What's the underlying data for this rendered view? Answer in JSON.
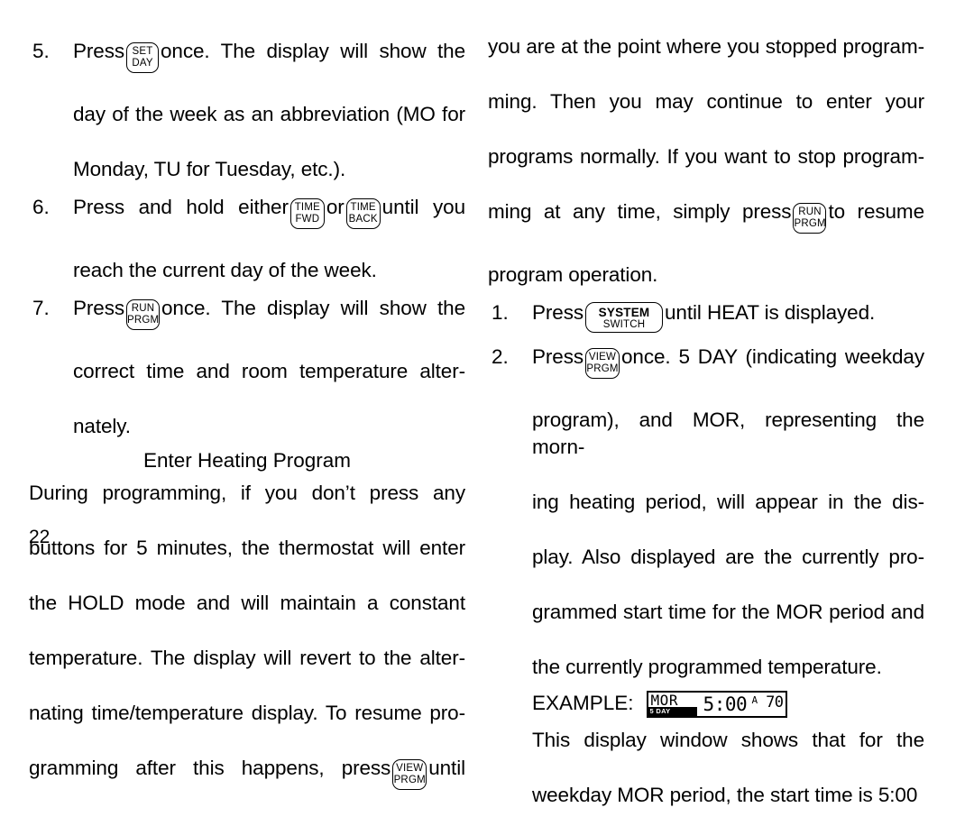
{
  "page": {
    "number": "22"
  },
  "keys": {
    "set_day": {
      "line1": "SET",
      "line2": "DAY"
    },
    "time_fwd": {
      "line1": "TIME",
      "line2": "FWD"
    },
    "time_back": {
      "line1": "TIME",
      "line2": "BACK"
    },
    "run_prgm": {
      "line1": "RUN",
      "line2": "PRGM"
    },
    "view_prgm": {
      "line1": "VIEW",
      "line2": "PRGM"
    },
    "system_switch": {
      "line1": "SYSTEM",
      "line2": "SWITCH"
    }
  },
  "left_column": {
    "step5": {
      "number": "5.",
      "seg_a": "Press",
      "seg_b": "once. The display will show the",
      "line2": "day of the week as an abbreviation (MO for",
      "line3": "Monday, TU for Tuesday, etc.)."
    },
    "step6": {
      "number": "6.",
      "seg_a": "Press and hold either",
      "seg_b": "or",
      "seg_c": "until you",
      "line2": "reach the current day of the week."
    },
    "step7": {
      "number": "7.",
      "seg_a": "Press",
      "seg_b": "once. The display will show the",
      "line2": "correct time and room temperature alter-",
      "line3": "nately."
    },
    "heading": "Enter Heating Program",
    "body": {
      "line1": "During programming, if you don’t press any",
      "line2": "buttons for 5 minutes, the thermostat will enter",
      "line3": "the HOLD mode and will maintain a constant",
      "line4": "temperature. The display will revert to the alter-",
      "line5": "nating time/temperature display. To resume pro-",
      "line6_a": "gramming after this happens, press",
      "line6_b": "until"
    }
  },
  "right_column": {
    "continuation": {
      "line1": "you are at the point where you stopped program-",
      "line2": "ming. Then you may continue to enter your",
      "line3": "programs normally. If you want to stop program-",
      "line4_a": "ming at any time, simply press",
      "line4_b": "to resume",
      "line5": "program operation."
    },
    "step1": {
      "number": "1.",
      "seg_a": "Press",
      "seg_b": "until HEAT is displayed."
    },
    "step2": {
      "number": "2.",
      "seg_a": "Press",
      "seg_b": "once. 5 DAY (indicating weekday",
      "line2": "program), and MOR, representing the morn-",
      "line3": "ing heating period, will appear in the dis-",
      "line4": "play. Also displayed are the currently pro-",
      "line5": "grammed start time for the MOR period and",
      "line6": "the currently programmed temperature."
    },
    "example": {
      "label": "EXAMPLE:",
      "lcd": {
        "mode": "MOR",
        "day_band": "5 DAY",
        "time": "5:00",
        "ampm": "A",
        "temperature": "70"
      }
    },
    "closing": {
      "line1": "This display window shows that for the",
      "line2": "weekday MOR period, the start time is 5:00"
    }
  }
}
